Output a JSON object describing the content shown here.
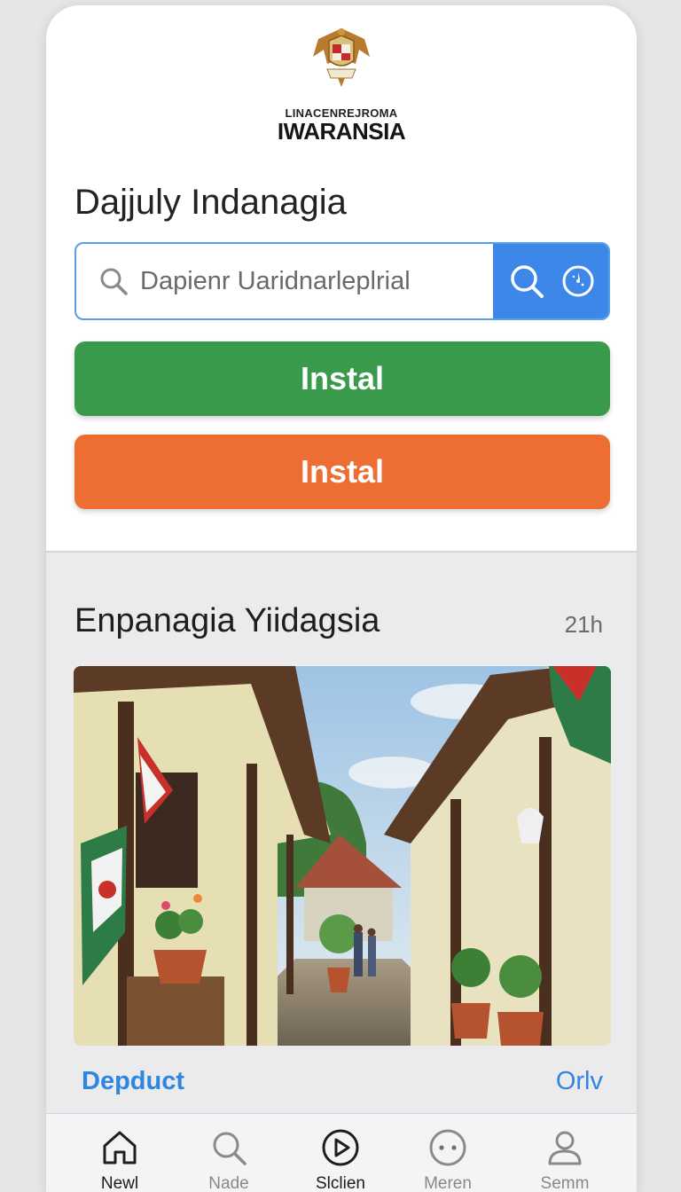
{
  "brand": {
    "small": "LINACENREJROMA",
    "big": "IWARANSIA"
  },
  "page_title": "Dajjuly Indanagia",
  "search": {
    "placeholder": "Dapienr Uaridnarleplrial",
    "icon": "search-icon",
    "button_icons": [
      "search-icon",
      "compass-icon"
    ]
  },
  "buttons": {
    "primary_label": "Instal",
    "secondary_label": "Instal"
  },
  "feed": {
    "title": "Enpanagia Yiidagsia",
    "time": "21h",
    "left_link": "Depduct",
    "right_link": "Orlv"
  },
  "tabs": [
    {
      "label": "Newl",
      "icon": "home-icon",
      "active": true
    },
    {
      "label": "Nade",
      "icon": "search-icon",
      "active": false
    },
    {
      "label": "Slclien",
      "icon": "play-icon",
      "active": false
    },
    {
      "label": "Meren",
      "icon": "more-icon",
      "active": false
    },
    {
      "label": "Semm",
      "icon": "profile-icon",
      "active": false
    }
  ],
  "colors": {
    "accent_blue": "#3d87e8",
    "green_button": "#3a9a4b",
    "orange_button": "#ed6e32",
    "link_blue": "#2e86e0"
  }
}
